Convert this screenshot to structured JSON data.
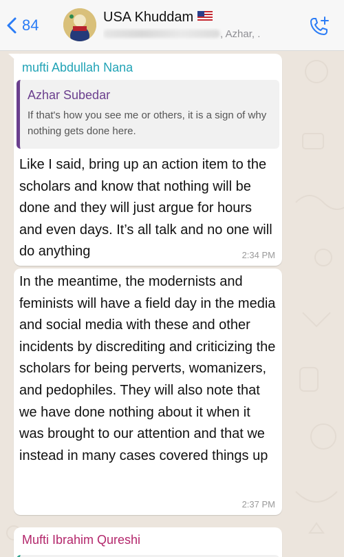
{
  "header": {
    "back_count": "84",
    "group_name": "USA Khuddam",
    "members_suffix": ", Azhar, ."
  },
  "messages": [
    {
      "sender": "mufti Abdullah Nana",
      "sender_color": "#21a3b6",
      "quote": {
        "name": "Azhar Subedar",
        "text": "If that's how you see me or others, it is a sign of why nothing gets done here."
      },
      "text": "Like I said, bring up an action item to the scholars and know that nothing will be done and they will just argue for hours and even days. It’s all talk and no one will do anything",
      "time": "2:34 PM"
    },
    {
      "text": "In the meantime, the modernists and feminists will have a field day in the media and social media with these and other incidents by discrediting and criticizing the scholars for being perverts, womanizers, and pedophiles. They will also note that we have done nothing about it when it was brought to our attention and that we instead in many cases covered things up",
      "time": "2:37 PM"
    },
    {
      "sender": "Mufti Ibrahim Qureshi",
      "sender_color": "#b3266b"
    }
  ],
  "colors": {
    "accent": "#2a7cf6",
    "quote_bar": "#6b3f8e",
    "chat_bg": "#ece5dd"
  },
  "icons": [
    "chevron-left-icon",
    "add-call-icon"
  ]
}
